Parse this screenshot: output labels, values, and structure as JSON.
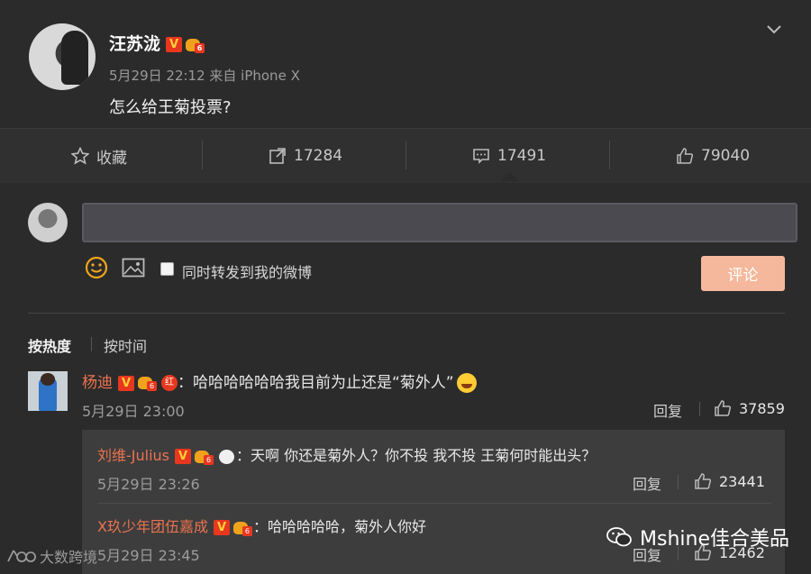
{
  "post": {
    "author": "汪苏泷",
    "meta": "5月29日 22:12 来自 iPhone X",
    "text": "怎么给王菊投票?"
  },
  "actions": {
    "favorite": "收藏",
    "repost_count": "17284",
    "comment_count": "17491",
    "like_count": "79040"
  },
  "composer": {
    "input_value": "",
    "sync_label": "同时转发到我的微博",
    "submit_label": "评论"
  },
  "sort": {
    "hot": "按热度",
    "time": "按时间"
  },
  "comment": {
    "author": "杨迪",
    "text": "：哈哈哈哈哈哈我目前为止还是“菊外人”",
    "time": "5月29日 23:00",
    "reply_label": "回复",
    "likes": "37859"
  },
  "replies": [
    {
      "author": "刘维-Julius",
      "text": "：天啊 你还是菊外人？你不投 我不投 王菊何时能出头？",
      "time": "5月29日 23:26",
      "reply_label": "回复",
      "likes": "23441"
    },
    {
      "author": "X玖少年团伍嘉成",
      "text": "：哈哈哈哈哈，菊外人你好",
      "time": "5月29日 23:45",
      "reply_label": "回复",
      "likes": "12462"
    }
  ],
  "watermarks": {
    "left": "大数跨境",
    "right": "Mshine佳合美品"
  },
  "colors": {
    "name_link": "#eb7350",
    "submit_bg": "#f5b89c",
    "accent": "#ee7a2f"
  }
}
